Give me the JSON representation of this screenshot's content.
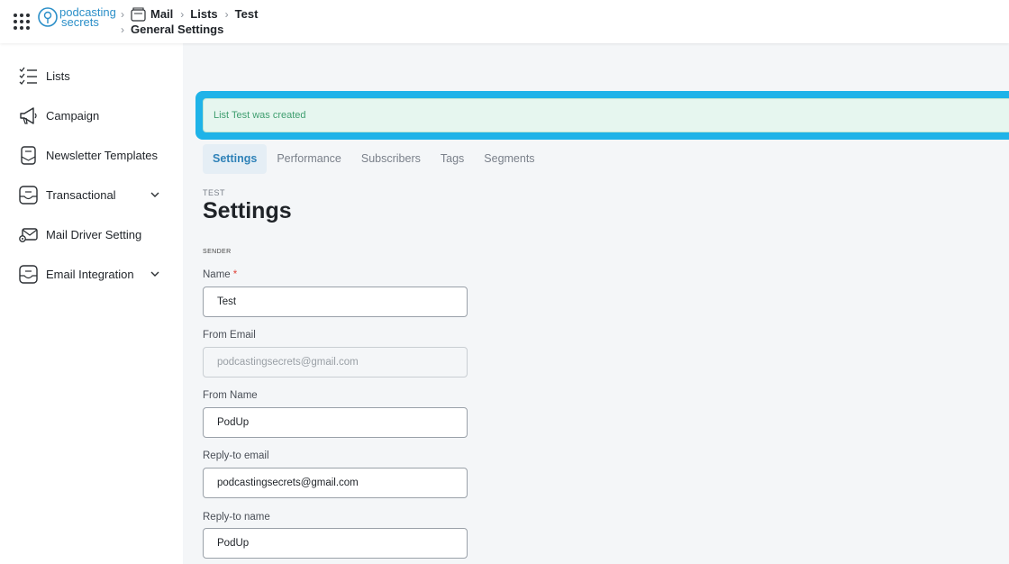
{
  "topbar": {
    "logo_line1": "podcasting",
    "logo_line2": "secrets",
    "breadcrumb": {
      "mail": "Mail",
      "lists": "Lists",
      "test": "Test",
      "general_settings": "General Settings"
    }
  },
  "sidebar": {
    "items": [
      {
        "label": "Lists",
        "icon": "checklist-icon"
      },
      {
        "label": "Campaign",
        "icon": "megaphone-icon"
      },
      {
        "label": "Newsletter Templates",
        "icon": "newsletter-icon"
      },
      {
        "label": "Transactional",
        "icon": "inbox-icon",
        "expandable": true
      },
      {
        "label": "Mail Driver Setting",
        "icon": "mail-gear-icon"
      },
      {
        "label": "Email Integration",
        "icon": "inbox-icon",
        "expandable": true
      }
    ]
  },
  "alert": {
    "message": "List Test was created",
    "color": "#3f9e6f"
  },
  "tabs": [
    {
      "label": "Settings",
      "active": true
    },
    {
      "label": "Performance"
    },
    {
      "label": "Subscribers"
    },
    {
      "label": "Tags"
    },
    {
      "label": "Segments"
    }
  ],
  "page": {
    "eyebrow": "TEST",
    "title": "Settings",
    "section": "SENDER"
  },
  "form": {
    "name": {
      "label": "Name",
      "required_mark": "*",
      "value": "Test"
    },
    "from_email": {
      "label": "From Email",
      "value": "podcastingsecrets@gmail.com",
      "disabled": true
    },
    "from_name": {
      "label": "From Name",
      "value": "PodUp"
    },
    "reply_to_email": {
      "label": "Reply-to email",
      "value": "podcastingsecrets@gmail.com"
    },
    "reply_to_name": {
      "label": "Reply-to name",
      "value": "PodUp"
    }
  },
  "colors": {
    "accent": "#2f82b8",
    "highlight": "#1fb3e8",
    "alert_bg": "#e6f6ef"
  }
}
